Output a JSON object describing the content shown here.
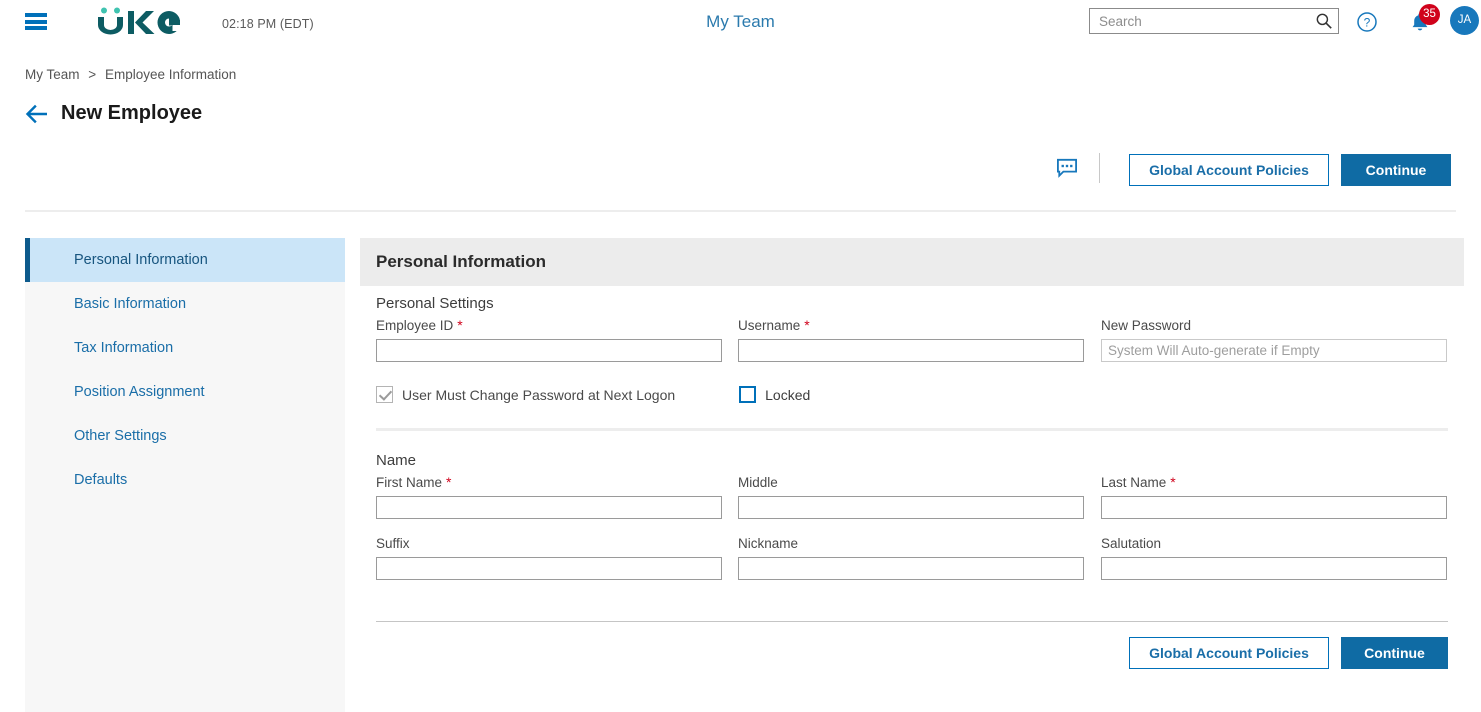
{
  "header": {
    "menu_icon": "hamburger-menu-icon",
    "logo_text": "UKG",
    "time": "02:18 PM (EDT)",
    "title": "My Team",
    "search": {
      "placeholder": "Search",
      "value": "",
      "icon": "search-icon"
    },
    "help_icon": "help-circle-icon",
    "notifications": {
      "icon": "bell-icon",
      "count": "35"
    },
    "avatar_initials": "JA"
  },
  "breadcrumb": {
    "items": [
      {
        "label": "My Team"
      },
      {
        "label": "Employee Information"
      }
    ],
    "separator": ">"
  },
  "page": {
    "back_icon": "back-arrow-icon",
    "title": "New Employee"
  },
  "action_bar": {
    "comment_icon": "comment-bubble-icon",
    "global_account_policies_label": "Global Account Policies",
    "continue_label": "Continue"
  },
  "sidebar": {
    "items": [
      {
        "label": "Personal Information",
        "selected": true
      },
      {
        "label": "Basic Information",
        "selected": false
      },
      {
        "label": "Tax Information",
        "selected": false
      },
      {
        "label": "Position Assignment",
        "selected": false
      },
      {
        "label": "Other Settings",
        "selected": false
      },
      {
        "label": "Defaults",
        "selected": false
      }
    ]
  },
  "main": {
    "panel_title": "Personal Information",
    "personal_settings": {
      "section_label": "Personal Settings",
      "fields": [
        {
          "label": "Employee ID",
          "required": true,
          "value": "",
          "placeholder": ""
        },
        {
          "label": "Username",
          "required": true,
          "value": "",
          "placeholder": ""
        },
        {
          "label": "New Password",
          "required": false,
          "value": "",
          "placeholder": "System Will Auto-generate if Empty"
        }
      ],
      "checkboxes": [
        {
          "label": "User Must Change Password at Next Logon",
          "checked": true,
          "disabled": true
        },
        {
          "label": "Locked",
          "checked": false,
          "disabled": false
        }
      ]
    },
    "name": {
      "section_label": "Name",
      "fields": [
        {
          "label": "First Name",
          "required": true,
          "value": "",
          "placeholder": ""
        },
        {
          "label": "Middle",
          "required": false,
          "value": "",
          "placeholder": ""
        },
        {
          "label": "Last Name",
          "required": true,
          "value": "",
          "placeholder": ""
        },
        {
          "label": "Suffix",
          "required": false,
          "value": "",
          "placeholder": ""
        },
        {
          "label": "Nickname",
          "required": false,
          "value": "",
          "placeholder": ""
        },
        {
          "label": "Salutation",
          "required": false,
          "value": "",
          "placeholder": ""
        }
      ]
    },
    "footer": {
      "global_account_policies_label": "Global Account Policies",
      "continue_label": "Continue"
    }
  },
  "colors": {
    "brand_teal": "#0d5c63",
    "brand_teal_light": "#3fc3b0",
    "accent_blue": "#0070b9",
    "primary_button": "#0f6ba4",
    "link_blue": "#1a6ea8",
    "selected_row": "#cbe5f8",
    "required_red": "#d0021b",
    "badge_red": "#d0021b",
    "panel_header_gray": "#ececec",
    "sidebar_gray": "#f7f7f7"
  }
}
